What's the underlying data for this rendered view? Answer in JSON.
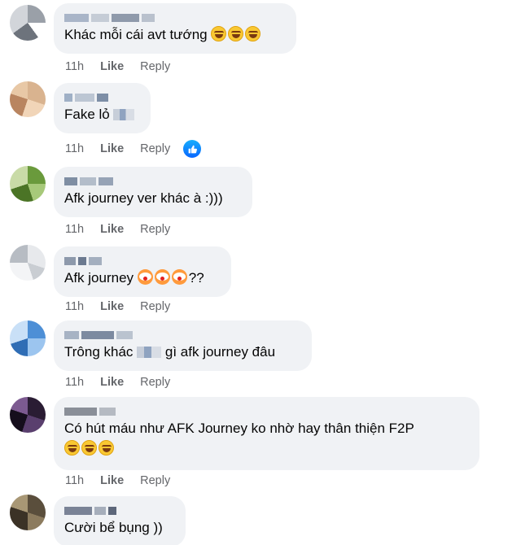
{
  "comments": [
    {
      "text": "Khác mỗi cái avt tướng",
      "time": "11h",
      "like_label": "Like",
      "reply_label": "Reply",
      "emojis": [
        "laugh",
        "laugh",
        "laugh"
      ]
    },
    {
      "text": "Fake lỏ",
      "time": "11h",
      "like_label": "Like",
      "reply_label": "Reply",
      "has_reaction": true,
      "reaction_icon": "thumbs-up-icon"
    },
    {
      "text": "Afk journey ver khác à :)))",
      "time": "11h",
      "like_label": "Like",
      "reply_label": "Reply"
    },
    {
      "text": "Afk journey",
      "suffix": "??",
      "time": "11h",
      "like_label": "Like",
      "reply_label": "Reply",
      "emojis": [
        "clown",
        "clown",
        "clown"
      ]
    },
    {
      "text_before": "Trông khác",
      "text_after": "gì afk journey đâu",
      "time": "11h",
      "like_label": "Like",
      "reply_label": "Reply"
    },
    {
      "text": "Có hút máu như AFK Journey ko nhờ hay thân thiện F2P",
      "time": "11h",
      "like_label": "Like",
      "reply_label": "Reply",
      "emojis": [
        "laugh",
        "laugh",
        "laugh"
      ]
    },
    {
      "text": "Cười bể bụng ))",
      "time": "",
      "like_label": "",
      "reply_label": ""
    }
  ],
  "colors": {
    "bubble": "#f0f2f5",
    "meta_text": "#65676b",
    "like_reaction": "#0866ff"
  }
}
